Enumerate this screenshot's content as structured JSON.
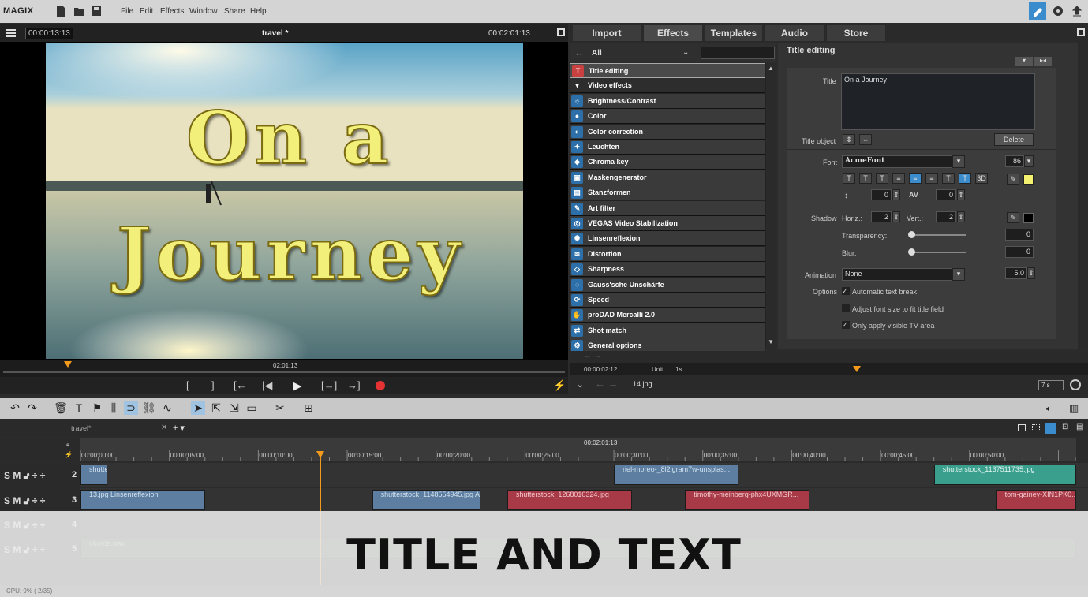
{
  "app": {
    "logo": "MAGIX"
  },
  "menu": [
    "File",
    "Edit",
    "Effects",
    "Window",
    "Share",
    "Help"
  ],
  "preview": {
    "left_timecode": "00:00:13:13",
    "title": "travel *",
    "right_timecode": "00:02:01:13",
    "overlay_line1": "On a",
    "overlay_line2": "Journey",
    "scrub_timecode": "02:01:13",
    "transport": [
      "[",
      "]",
      "[←",
      "|◀",
      "▶",
      "[→]",
      "→]"
    ]
  },
  "tabs": [
    "Import",
    "Effects",
    "Templates",
    "Audio",
    "Store"
  ],
  "effects": {
    "filter": "All",
    "items": [
      {
        "label": "Title editing",
        "icon": "T"
      },
      {
        "label": "Video effects",
        "icon": "▾"
      },
      {
        "label": "Brightness/Contrast",
        "icon": "☼"
      },
      {
        "label": "Color",
        "icon": "●"
      },
      {
        "label": "Color correction",
        "icon": "◐"
      },
      {
        "label": "Leuchten",
        "icon": "✦"
      },
      {
        "label": "Chroma key",
        "icon": "◆"
      },
      {
        "label": "Maskengenerator",
        "icon": "▣"
      },
      {
        "label": "Stanzformen",
        "icon": "▤"
      },
      {
        "label": "Art filter",
        "icon": "✎"
      },
      {
        "label": "VEGAS Video Stabilization",
        "icon": "◎"
      },
      {
        "label": "Linsenreflexion",
        "icon": "✺"
      },
      {
        "label": "Distortion",
        "icon": "≋"
      },
      {
        "label": "Sharpness",
        "icon": "◇"
      },
      {
        "label": "Gauss'sche Unschärfe",
        "icon": "◌"
      },
      {
        "label": "Speed",
        "icon": "⟳"
      },
      {
        "label": "proDAD Mercalli 2.0",
        "icon": "✋"
      },
      {
        "label": "Shot match",
        "icon": "⇄"
      },
      {
        "label": "General options",
        "icon": "⚙"
      }
    ]
  },
  "title_editing": {
    "heading": "Title editing",
    "title_label": "Title",
    "title_value": "On a Journey",
    "title_object_label": "Title object",
    "delete_label": "Delete",
    "font_label": "Font",
    "font_value": "AcmeFont",
    "font_size": "86",
    "font_color": "#f4f070",
    "style_buttons": [
      "T",
      "T",
      "T",
      "≡",
      "≡",
      "≡",
      "T",
      "T",
      "3D"
    ],
    "spacing1": "0",
    "av_label": "AV",
    "spacing2": "0",
    "shadow_label": "Shadow",
    "horiz_label": "Horiz.:",
    "horiz_value": "2",
    "vert_label": "Vert.:",
    "vert_value": "2",
    "transparency_label": "Transparency:",
    "transparency_value": "0",
    "blur_label": "Blur:",
    "blur_value": "0",
    "animation_label": "Animation",
    "animation_value": "None",
    "animation_duration": "5.0",
    "options_label": "Options",
    "opt1": "Automatic text break",
    "opt2": "Adjust font size to fit title field",
    "opt3": "Only apply visible TV area"
  },
  "media_bar": {
    "timecode": "00:00:02:12",
    "unit_label": "Unit:",
    "unit_value": "1s",
    "file": "14.jpg",
    "duration": "7 s"
  },
  "timeline": {
    "project_tab": "travel*",
    "cursor_timecode": "00:02:01:13",
    "ruler": [
      "00:00:00:00",
      "00:00:05:00",
      "00:00:10:00",
      "00:00:15:00",
      "00:00:20:00",
      "00:00:25:00",
      "00:00:30:00",
      "00:00:35:00",
      "00:00:40:00",
      "00:00:45:00",
      "00:00:50:00"
    ],
    "tracks": [
      {
        "num": "2",
        "clips": [
          {
            "label": "shutterst...",
            "color": "blue",
            "start": 0,
            "end": 1.5
          },
          {
            "label": "riel-moreo-_8l2igram7w-unsplas...",
            "color": "blue",
            "start": 30,
            "end": 37
          },
          {
            "label": "shutterstock_1137511735.jpg",
            "color": "teal",
            "start": 48,
            "end": 56
          }
        ]
      },
      {
        "num": "3",
        "clips": [
          {
            "label": "13.jpg   Linsenreflexion",
            "color": "blue",
            "start": 0,
            "end": 7
          },
          {
            "label": "shutterstock_1148554945.jpg   Art...",
            "color": "blue",
            "start": 16.4,
            "end": 22.5
          },
          {
            "label": "shutterstock_1268010324.jpg",
            "color": "red",
            "start": 24,
            "end": 31
          },
          {
            "label": "timothy-meinberg-phx4UXMGR...",
            "color": "red",
            "start": 34,
            "end": 41
          },
          {
            "label": "tom-gainey-XIN1PK0...",
            "color": "red",
            "start": 51.5,
            "end": 56
          }
        ]
      },
      {
        "num": "4",
        "clips": []
      },
      {
        "num": "5",
        "clips": [
          {
            "label": "chords.wav",
            "color": "audio",
            "start": 0,
            "end": 56
          }
        ]
      }
    ],
    "cursor_seconds": 13.5,
    "seconds_span": 56
  },
  "banner": "TITLE AND TEXT",
  "status": "CPU: 9% ( 2/35)"
}
